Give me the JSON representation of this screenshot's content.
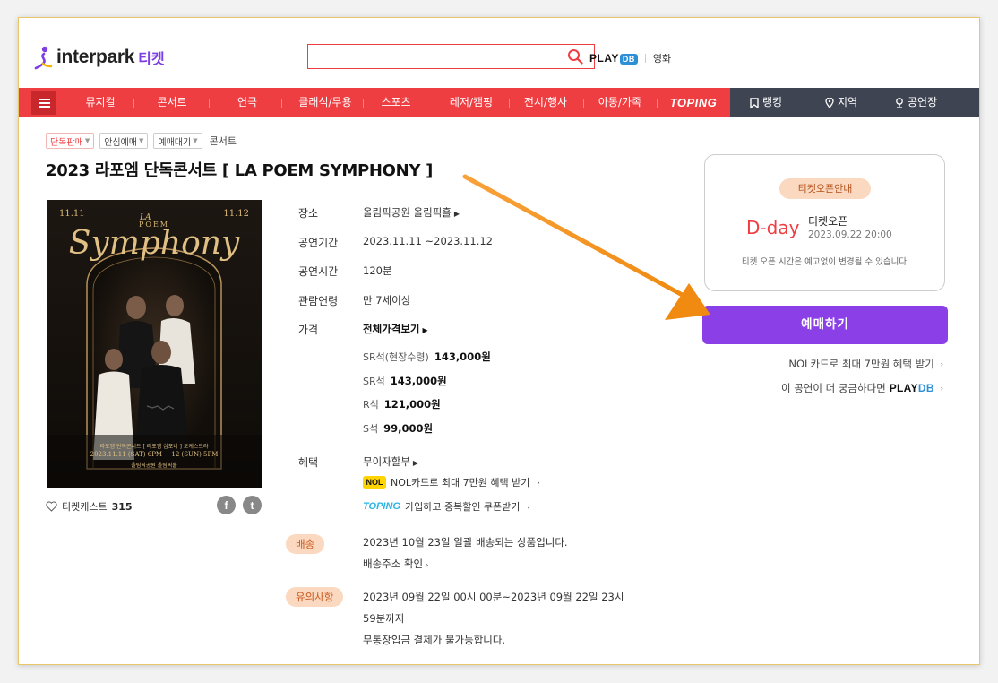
{
  "header": {
    "logo_text": "interpark",
    "logo_ticket": "티켓",
    "search_placeholder": "",
    "playdb_label": "PLAY",
    "playdb_db": "DB",
    "movie_link": "영화"
  },
  "nav": {
    "items": [
      "뮤지컬",
      "콘서트",
      "연극",
      "클래식/무용",
      "스포츠",
      "레저/캠핑",
      "전시/행사",
      "아동/가족",
      "TOPING"
    ],
    "right_items": [
      "랭킹",
      "지역",
      "공연장"
    ]
  },
  "breadcrumb": {
    "chips": [
      "단독판매",
      "안심예매",
      "예매대기"
    ],
    "category": "콘서트"
  },
  "title": "2023 라포엠 단독콘서트  [ LA POEM SYMPHONY ]",
  "poster": {
    "date_left": "11.11",
    "date_right": "11.12",
    "la_text": "LA",
    "poem_text": "POEM",
    "symphony_text": "Symphony",
    "caption_line1": "라포엠 단독콘서트 [ 라포엠 심포니 ] 오케스트라",
    "caption_line2": "2023.11.11 (SAT) 6PM ~ 12 (SUN) 5PM",
    "caption_line3": "올림픽공원 올림픽홀"
  },
  "wishlist": {
    "label": "티켓캐스트",
    "count": "315"
  },
  "share": {
    "facebook": "f",
    "twitter": "t"
  },
  "info": {
    "venue_label": "장소",
    "venue_value": "올림픽공원 올림픽홀",
    "period_label": "공연기간",
    "period_value": "2023.11.11 ~2023.11.12",
    "runtime_label": "공연시간",
    "runtime_value": "120분",
    "age_label": "관람연령",
    "age_value": "만 7세이상",
    "price_label": "가격",
    "price_all": "전체가격보기",
    "prices": [
      {
        "seat": "SR석(현장수령)",
        "amount": "143,000원"
      },
      {
        "seat": "SR석",
        "amount": "143,000원"
      },
      {
        "seat": "R석",
        "amount": "121,000원"
      },
      {
        "seat": "S석",
        "amount": "99,000원"
      }
    ],
    "benefit_label": "혜택",
    "benefit_installment": "무이자할부",
    "benefit_nol_icon": "NOL",
    "benefit_nol": "NOL카드로 최대 7만원 혜택 받기",
    "benefit_toping_icon": "TOPING",
    "benefit_toping": "가입하고 중복할인 쿠폰받기",
    "delivery_label": "배송",
    "delivery_text": "2023년 10월 23일 일괄 배송되는 상품입니다.",
    "delivery_link": "배송주소 확인",
    "notice_label": "유의사항",
    "notice_line1": "2023년 09월 22일 00시 00분~2023년 09월 22일 23시",
    "notice_line2": "59분까지",
    "notice_line3": "무통장입금 결제가 불가능합니다."
  },
  "open_box": {
    "badge": "티켓오픈안내",
    "dday": "D-day",
    "open_label": "티켓오픈",
    "open_date": "2023.09.22 20:00",
    "note": "티켓 오픈 시간은 예고없이 변경될 수 있습니다."
  },
  "booking": {
    "button": "예매하기",
    "nol_link": "NOL카드로 최대 7만원 혜택 받기",
    "playdb_prefix": "이 공연이 더 궁금하다면",
    "playdb_play": "PLAY",
    "playdb_db": "DB"
  },
  "colors": {
    "nav_red": "#ef3e42",
    "nav_dark": "#3e4451",
    "book_purple": "#8b3fe7",
    "accent_orange": "#f7941d"
  }
}
